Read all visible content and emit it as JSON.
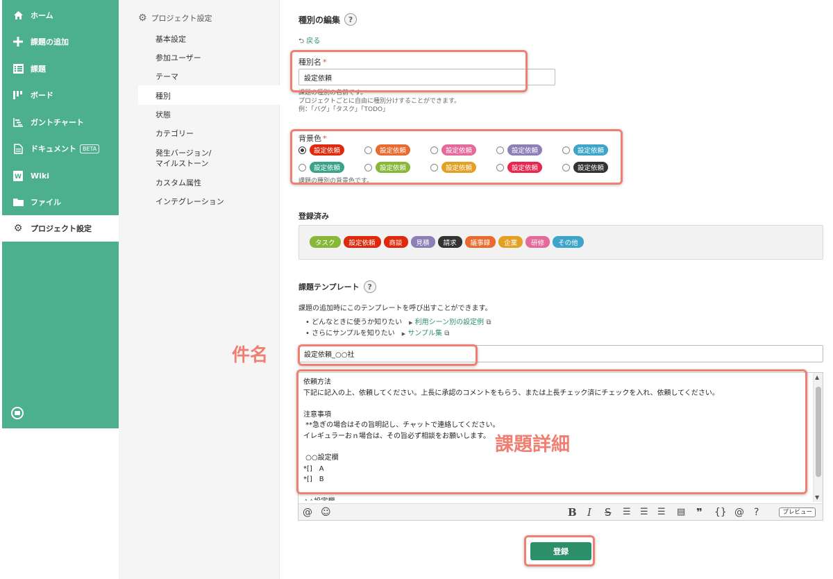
{
  "sidebar": {
    "items": [
      {
        "label": "ホーム",
        "icon": "home-icon"
      },
      {
        "label": "課題の追加",
        "icon": "plus-icon"
      },
      {
        "label": "課題",
        "icon": "list-icon"
      },
      {
        "label": "ボード",
        "icon": "board-icon"
      },
      {
        "label": "ガントチャート",
        "icon": "gantt-icon"
      },
      {
        "label": "ドキュメント",
        "icon": "document-icon",
        "badge": "BETA"
      },
      {
        "label": "Wiki",
        "icon": "wiki-icon"
      },
      {
        "label": "ファイル",
        "icon": "folder-icon"
      },
      {
        "label": "プロジェクト設定",
        "icon": "gear-icon"
      }
    ],
    "color": "#4caf8e"
  },
  "settings_menu": {
    "title": "プロジェクト設定",
    "items": [
      "基本設定",
      "参加ユーザー",
      "テーマ",
      "種別",
      "状態",
      "カテゴリー",
      "発生バージョン/",
      "マイルストーン",
      "カスタム属性",
      "インテグレーション"
    ],
    "active": "種別"
  },
  "page": {
    "title": "種別の編集",
    "help": "?",
    "back": "戻る"
  },
  "type_name": {
    "label": "種別名",
    "required": "*",
    "value": "設定依頼",
    "hint1": "課題の種別の名前です。",
    "hint2": "プロジェクトごとに自由に種別分けすることができます。",
    "hint3": "例：「バグ」「タスク」「TODO」"
  },
  "bg_color": {
    "label": "背景色",
    "required": "*",
    "hint": "課題の種別の背景色です。",
    "chip_label": "設定依頼",
    "options": [
      {
        "color": "#e0290c",
        "checked": true
      },
      {
        "color": "#e86a2e",
        "checked": false
      },
      {
        "color": "#e5699b",
        "checked": false
      },
      {
        "color": "#8c7fb5",
        "checked": false
      },
      {
        "color": "#3ca5c9",
        "checked": false
      },
      {
        "color": "#3aa387",
        "checked": false
      },
      {
        "color": "#88b83a",
        "checked": false
      },
      {
        "color": "#e3a024",
        "checked": false
      },
      {
        "color": "#e8264e",
        "checked": false
      },
      {
        "color": "#333333",
        "checked": false
      }
    ]
  },
  "registered": {
    "label": "登録済み",
    "chips": [
      {
        "label": "タスク",
        "color": "#88b83a"
      },
      {
        "label": "設定依頼",
        "color": "#e0290c"
      },
      {
        "label": "商談",
        "color": "#e0290c"
      },
      {
        "label": "見積",
        "color": "#8c7fb5"
      },
      {
        "label": "請求",
        "color": "#333333"
      },
      {
        "label": "議事録",
        "color": "#e86a2e"
      },
      {
        "label": "企業",
        "color": "#e3a024"
      },
      {
        "label": "研修",
        "color": "#e5699b"
      },
      {
        "label": "その他",
        "color": "#3ca5c9"
      }
    ]
  },
  "template": {
    "label": "課題テンプレート",
    "help": "?",
    "desc": "課題の追加時にこのテンプレートを呼び出すことができます。",
    "bullet1_text": "どんなときに使うか知りたい",
    "bullet1_link": "利用シーン別の設定例",
    "bullet2_text": "さらにサンプルを知りたい",
    "bullet2_link": "サンプル集",
    "subject_value": "設定依頼_○○社",
    "body_lines": [
      "依頼方法",
      "下記に記入の上、依頼してください。上長に承認のコメントをもらう、または上長チェック済にチェックを入れ、依頼してください。",
      "",
      "注意事項",
      " **急ぎの場合はその旨明記し、チャットで連絡してください。",
      "イレギュラーおｎ場合は、その旨必ず相談をお願いします。",
      "",
      " ○○設定欄",
      "*[]　A",
      "*[]　B",
      "",
      "△△設定欄"
    ],
    "preview": "プレビュー"
  },
  "annotations": {
    "subject": "件名",
    "body": "課題詳細",
    "color": "#f07f72"
  },
  "submit_label": "登録"
}
